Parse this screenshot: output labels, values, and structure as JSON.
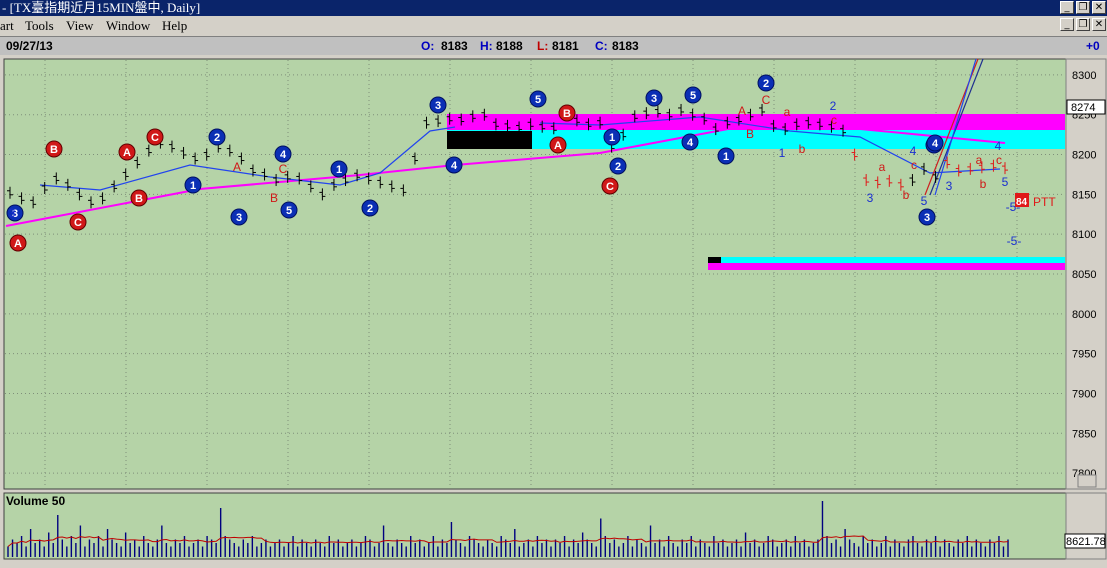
{
  "window": {
    "title": "- [TX臺指期近月15MIN盤中, Daily]",
    "minimize_glyph": "_",
    "restore_glyph": "❐",
    "close_glyph": "✕"
  },
  "menu": {
    "items": [
      "art",
      "Tools",
      "View",
      "Window",
      "Help"
    ]
  },
  "info_bar": {
    "date": "09/27/13",
    "open_label": "O:",
    "open": "8183",
    "high_label": "H:",
    "high": "8188",
    "low_label": "L:",
    "low": "8181",
    "close_label": "C:",
    "close": "8183",
    "change": "+0"
  },
  "colors": {
    "plot_bg": "#b5d3a7",
    "grid": "#7f8f7a",
    "magenta": "#ff00ff",
    "cyan": "#00ffff",
    "blue_circle": "#0b2fb5",
    "red_circle": "#d01818",
    "line_blue": "#2244ee",
    "volume": "#000080",
    "volume_ma": "#c00000"
  },
  "chart_data": {
    "type": "bar",
    "price_axis": {
      "ticks": [
        8300,
        8250,
        8200,
        8150,
        8100,
        8050,
        8000,
        7950,
        7900,
        7850,
        7800
      ],
      "ylim": [
        7780,
        8320
      ],
      "last_price_label": "8274",
      "extra_label": "PTT",
      "extra_box": "84"
    },
    "price_series": [
      8152,
      8145,
      8140,
      8158,
      8170,
      8162,
      8150,
      8140,
      8145,
      8160,
      8175,
      8190,
      8205,
      8215,
      8210,
      8202,
      8195,
      8200,
      8210,
      8205,
      8195,
      8180,
      8175,
      8168,
      8172,
      8170,
      8160,
      8150,
      8162,
      8168,
      8174,
      8170,
      8165,
      8160,
      8155,
      8195,
      8240,
      8242,
      8245,
      8244,
      8248,
      8250,
      8238,
      8236,
      8234,
      8238,
      8235,
      8233,
      8252,
      8243,
      8238,
      8240,
      8210,
      8225,
      8248,
      8252,
      8254,
      8250,
      8256,
      8250,
      8245,
      8232,
      8240,
      8244,
      8250,
      8256,
      8236,
      8232,
      8238,
      8240,
      8238,
      8235,
      8230,
      8200,
      8168,
      8165,
      8167,
      8162,
      8168,
      8182,
      8172,
      8190,
      8180,
      8182,
      8184,
      8186,
      8183
    ],
    "wave_labels_blue": [
      "3",
      "2",
      "1",
      "3",
      "4",
      "5",
      "1",
      "2",
      "3",
      "4",
      "5",
      "1",
      "2",
      "3",
      "5",
      "4",
      "1",
      "2",
      "3",
      "5",
      "3",
      "4"
    ],
    "wave_labels_red": [
      "A",
      "B",
      "C",
      "A",
      "B",
      "C",
      "A",
      "B",
      "C",
      "A",
      "B",
      "C",
      "C"
    ],
    "small_labels_red": [
      "A",
      "B",
      "C",
      "A",
      "C",
      "a",
      "b",
      "c",
      "a",
      "b",
      "c",
      "a",
      "b",
      "c"
    ],
    "small_labels_blue": [
      "3",
      "5",
      "1",
      "2",
      "3",
      "4",
      "5",
      "4",
      "5",
      "3",
      "5",
      "-5-",
      "-5-"
    ],
    "volume_panel": {
      "title": "Volume 50",
      "value_label": "8621.78",
      "values": [
        3,
        5,
        4,
        6,
        3,
        8,
        4,
        5,
        3,
        7,
        4,
        12,
        5,
        3,
        6,
        4,
        9,
        3,
        5,
        4,
        6,
        3,
        8,
        5,
        4,
        3,
        7,
        4,
        5,
        3,
        6,
        4,
        3,
        5,
        9,
        4,
        3,
        5,
        4,
        6,
        3,
        4,
        5,
        3,
        6,
        5,
        4,
        14,
        6,
        5,
        4,
        3,
        5,
        4,
        6,
        3,
        4,
        5,
        3,
        4,
        5,
        3,
        4,
        6,
        3,
        5,
        4,
        3,
        5,
        4,
        3,
        6,
        4,
        5,
        3,
        4,
        5,
        3,
        4,
        6,
        5,
        3,
        4,
        9,
        4,
        3,
        5,
        4,
        3,
        6,
        4,
        5,
        3,
        4,
        6,
        3,
        5,
        4,
        10,
        5,
        4,
        3,
        6,
        5,
        4,
        3,
        5,
        4,
        3,
        6,
        5,
        4,
        8,
        3,
        4,
        5,
        3,
        6,
        4,
        5,
        3,
        5,
        4,
        6,
        3,
        5,
        4,
        7,
        5,
        4,
        3,
        11,
        6,
        4,
        5,
        3,
        4,
        6,
        3,
        5,
        4,
        3,
        9,
        4,
        5,
        3,
        6,
        4,
        3,
        5,
        4,
        6,
        3,
        5,
        4,
        3,
        6,
        4,
        5,
        3,
        4,
        5,
        3,
        7,
        4,
        5,
        3,
        4,
        6,
        5,
        3,
        4,
        5,
        3,
        6,
        4,
        5,
        3,
        4,
        5,
        16,
        6,
        4,
        5,
        3,
        8,
        5,
        4,
        3,
        6,
        4,
        5,
        3,
        4,
        6,
        3,
        5,
        4,
        3,
        5,
        6,
        4,
        3,
        5,
        4,
        6,
        3,
        5,
        4,
        3,
        5,
        4,
        6,
        3,
        5,
        4,
        3,
        5,
        4,
        6,
        3,
        5
      ]
    }
  }
}
